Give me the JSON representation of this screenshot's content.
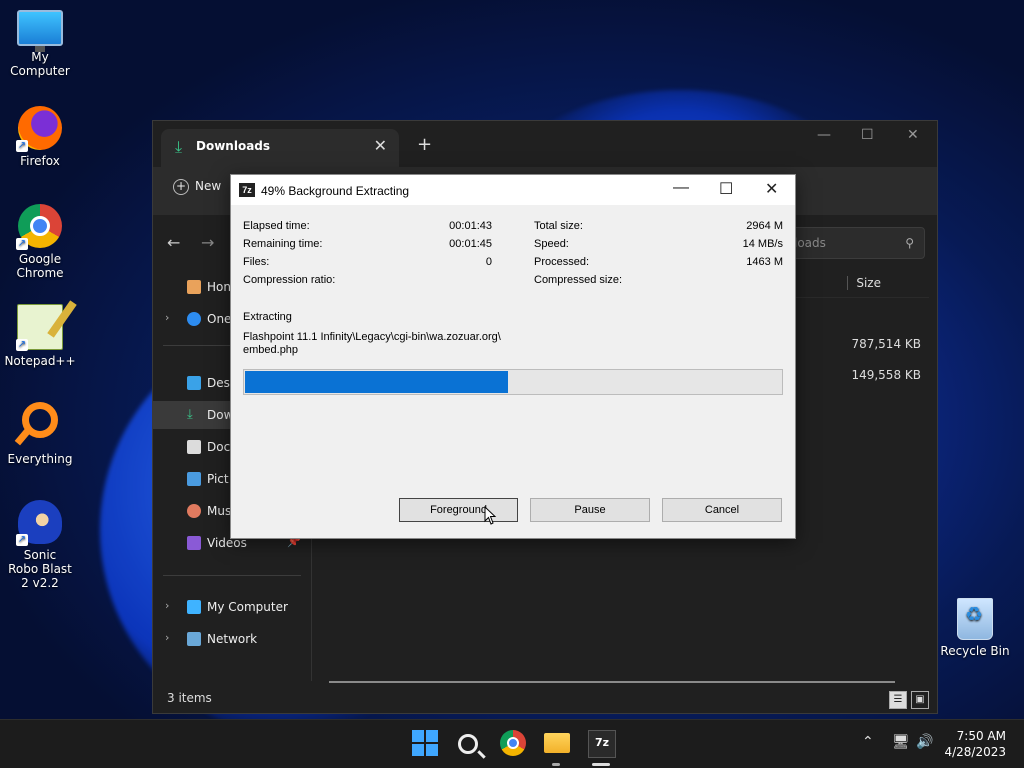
{
  "desktop": {
    "icons": [
      {
        "label": "My Computer"
      },
      {
        "label": "Firefox"
      },
      {
        "label": "Google Chrome"
      },
      {
        "label": "Notepad++"
      },
      {
        "label": "Everything"
      },
      {
        "label": "Sonic Robo Blast 2 v2.2"
      },
      {
        "label": "Recycle Bin"
      }
    ]
  },
  "explorer": {
    "tab_title": "Downloads",
    "new_label": "New",
    "search_placeholder": "loads",
    "sidebar": [
      {
        "label": "Hon"
      },
      {
        "label": "One"
      },
      {
        "label": "Desk"
      },
      {
        "label": "Dow"
      },
      {
        "label": "Doc"
      },
      {
        "label": "Pict"
      },
      {
        "label": "Mus"
      },
      {
        "label": "Videos"
      },
      {
        "label": "My Computer"
      },
      {
        "label": "Network"
      }
    ],
    "column_size": "Size",
    "files": [
      {
        "size": "787,514 KB"
      },
      {
        "size": "149,558 KB"
      }
    ],
    "status": "3 items"
  },
  "dialog": {
    "title": "49% Background Extracting",
    "app_icon": "7z",
    "left": [
      {
        "label": "Elapsed time:",
        "value": "00:01:43"
      },
      {
        "label": "Remaining time:",
        "value": "00:01:45"
      },
      {
        "label": "Files:",
        "value": "0"
      },
      {
        "label": "Compression ratio:",
        "value": ""
      }
    ],
    "right": [
      {
        "label": "Total size:",
        "value": "2964 M"
      },
      {
        "label": "Speed:",
        "value": "14 MB/s"
      },
      {
        "label": "Processed:",
        "value": "1463 M"
      },
      {
        "label": "Compressed size:",
        "value": ""
      }
    ],
    "status_label": "Extracting",
    "path_line1": "Flashpoint 11.1 Infinity\\Legacy\\cgi-bin\\wa.zozuar.org\\",
    "path_line2": "embed.php",
    "progress_percent": 49,
    "buttons": {
      "foreground": "Foreground",
      "pause": "Pause",
      "cancel": "Cancel"
    }
  },
  "taskbar": {
    "time": "7:50 AM",
    "date": "4/28/2023",
    "app7z": "7z"
  }
}
